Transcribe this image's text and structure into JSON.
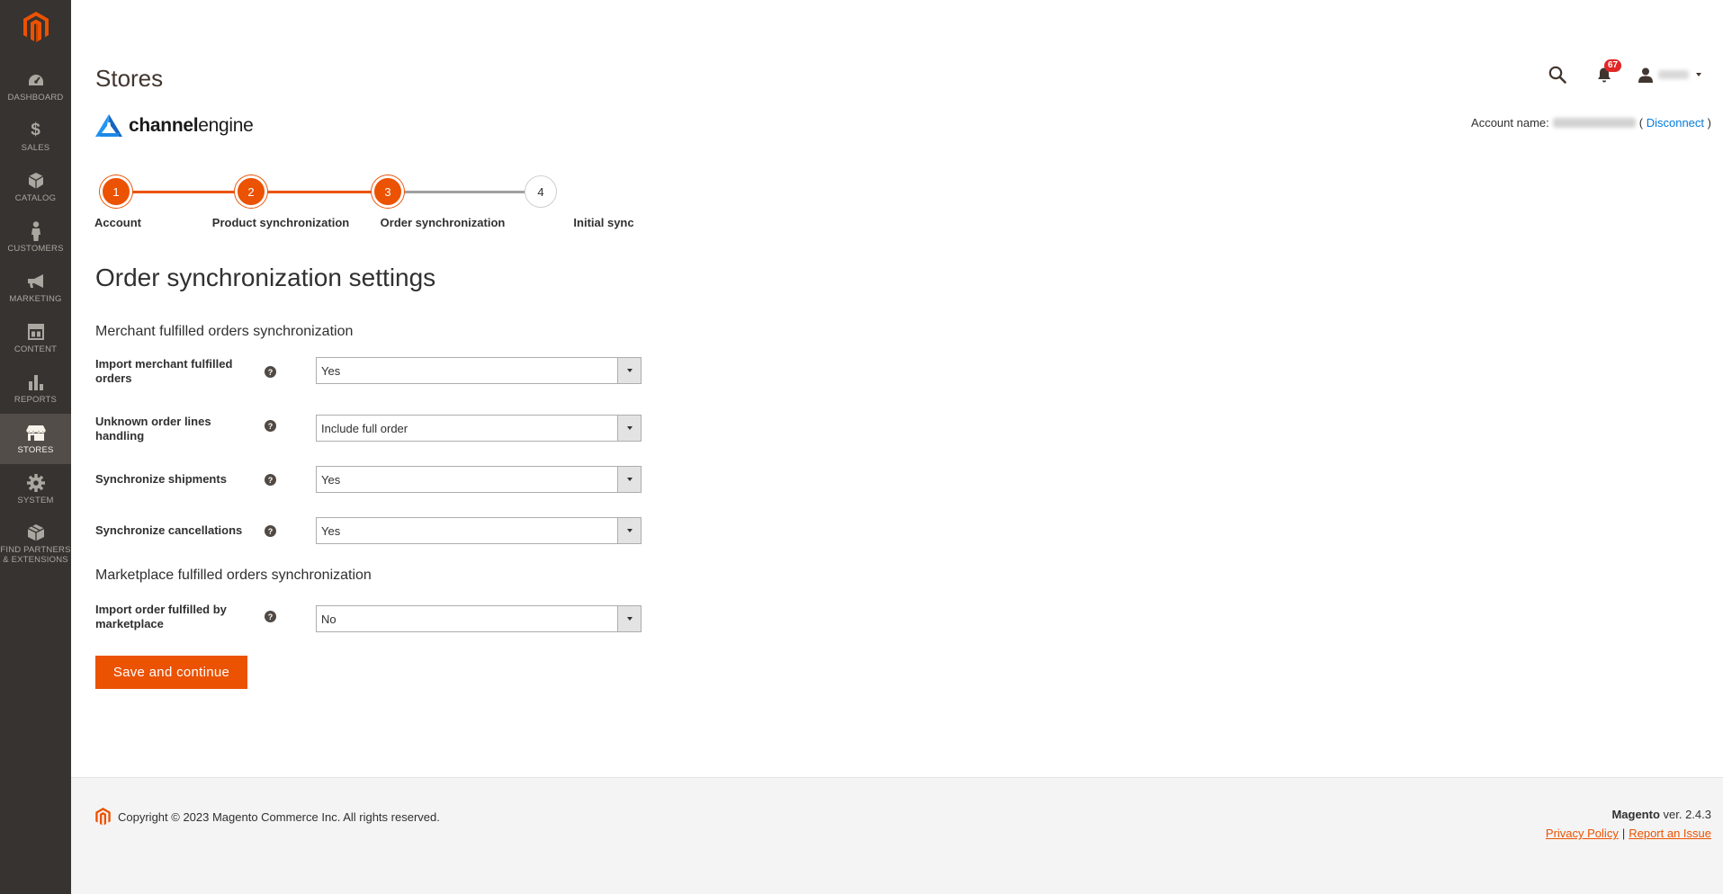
{
  "sidebar": {
    "items": [
      {
        "label": "DASHBOARD",
        "icon": "dashboard-icon"
      },
      {
        "label": "SALES",
        "icon": "dollar-icon"
      },
      {
        "label": "CATALOG",
        "icon": "catalog-box-icon"
      },
      {
        "label": "CUSTOMERS",
        "icon": "customer-person-icon"
      },
      {
        "label": "MARKETING",
        "icon": "megaphone-icon"
      },
      {
        "label": "CONTENT",
        "icon": "content-layout-icon"
      },
      {
        "label": "REPORTS",
        "icon": "bar-chart-icon"
      },
      {
        "label": "STORES",
        "icon": "storefront-icon",
        "active": true
      },
      {
        "label": "SYSTEM",
        "icon": "gear-icon"
      },
      {
        "label": "FIND PARTNERS & EXTENSIONS",
        "icon": "extensions-box-icon"
      }
    ]
  },
  "header": {
    "title": "Stores",
    "notification_count": "67"
  },
  "brand": {
    "name_bold": "channel",
    "name_light": "engine"
  },
  "account": {
    "label": "Account name:",
    "open_paren": "(",
    "disconnect": "Disconnect",
    "close_paren": ")"
  },
  "stepper": {
    "steps": [
      {
        "number": "1",
        "label": "Account",
        "state": "done"
      },
      {
        "number": "2",
        "label": "Product synchronization",
        "state": "done"
      },
      {
        "number": "3",
        "label": "Order synchronization",
        "state": "current"
      },
      {
        "number": "4",
        "label": "Initial sync",
        "state": "todo"
      }
    ]
  },
  "form": {
    "title": "Order synchronization settings",
    "merchant_section": "Merchant fulfilled orders synchronization",
    "marketplace_section": "Marketplace fulfilled orders synchronization",
    "fields": [
      {
        "label": "Import merchant fulfilled orders",
        "value": "Yes"
      },
      {
        "label": "Unknown order lines handling",
        "value": "Include full order"
      },
      {
        "label": "Synchronize shipments",
        "value": "Yes"
      },
      {
        "label": "Synchronize cancellations",
        "value": "Yes"
      },
      {
        "label": "Import order fulfilled by marketplace",
        "value": "No"
      }
    ],
    "help_glyph": "?",
    "save_label": "Save and continue"
  },
  "footer": {
    "copyright": "Copyright © 2023 Magento Commerce Inc. All rights reserved.",
    "brand": "Magento",
    "version": " ver. 2.4.3",
    "privacy": "Privacy Policy",
    "separator": "|",
    "report": "Report an Issue"
  },
  "colors": {
    "accent": "#eb5202",
    "sidebar_bg": "#373330",
    "link": "#007bdb"
  }
}
